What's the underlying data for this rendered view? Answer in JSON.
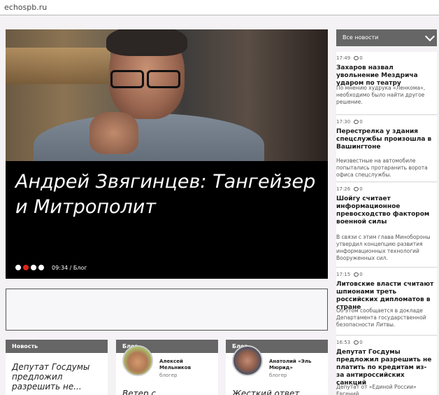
{
  "topbar": {
    "domain": "echospb.ru"
  },
  "hero": {
    "title": "Андрей Звягинцев: Тангейзер и Митрополит",
    "time": "09:34",
    "category": "Блог",
    "meta": "09:34 / Блог",
    "slides": 4,
    "active_slide": 2
  },
  "cards": [
    {
      "label": "Новость",
      "title": "Депутат Госдумы предложил разрешить не... "
    },
    {
      "label": "Блог",
      "author": "Алексей Мельников",
      "role": "блогер",
      "title": "Ветер с..."
    },
    {
      "label": "Блог",
      "author": "Анатолий «Эль Мюрид»",
      "role": "блогер",
      "title": "Жесткий ответ..."
    }
  ],
  "sidebar": {
    "header": "Все новости",
    "items": [
      {
        "time": "17:49",
        "comments": "0",
        "title": "Захаров назвал увольнение Мездрича ударом по театру",
        "lead": "По мнению худрука «Ленкома», необходимо было найти другое решение."
      },
      {
        "time": "17:30",
        "comments": "0",
        "title": "Перестрелка у здания спецслужбы произошла в Вашингтоне",
        "lead": "Неизвестные на автомобиле попытались протаранить ворота офиса спецслужбы."
      },
      {
        "time": "17:26",
        "comments": "0",
        "title": "Шойгу считает информационное превосходство фактором военной силы",
        "lead": "В связи с этим глава Минобороны утвердил концепцию развития информационных технологий Вооруженных сил."
      },
      {
        "time": "17:15",
        "comments": "0",
        "title": "Литовские власти считают шпионами треть российских дипломатов в стране",
        "lead": "Об этом сообщается в докладе Департамента государственной безопасности Литвы."
      },
      {
        "time": "16:53",
        "comments": "0",
        "title": "Депутат Госдумы предложил разрешить не платить по кредитам из-за антироссийских санкций",
        "lead": "Депутат от «Единой России» Евгений"
      }
    ]
  },
  "colors": {
    "accent": "#e0231c",
    "panel_header": "#666666",
    "hero_bg": "#000000"
  }
}
